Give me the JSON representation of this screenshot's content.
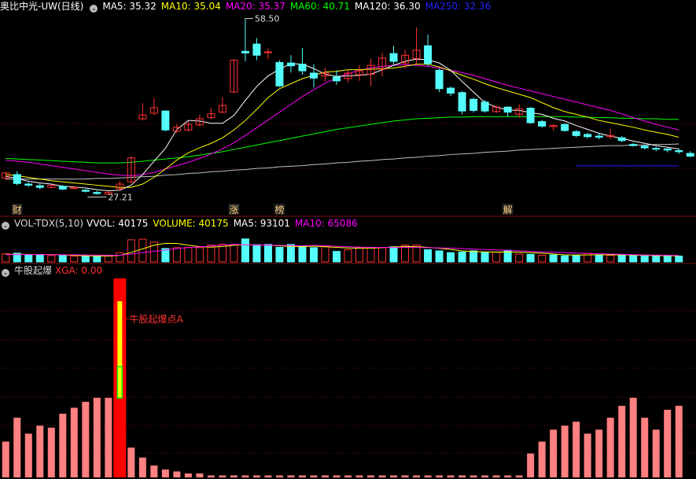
{
  "colors": {
    "up": "#ff3232",
    "down": "#54fcfc",
    "ma5": "#ffffff",
    "ma10": "#ffff00",
    "ma20": "#ff00ff",
    "ma60": "#00ff00",
    "ma120": "#c0c0c0",
    "ma250": "#2222ff",
    "grid": "#7a1010",
    "bg": "#000000"
  },
  "price_panel": {
    "stock_name": "奥比中光-UW(日线)",
    "indicators": [
      {
        "label": "MA5: 35.32",
        "color": "#ffffff"
      },
      {
        "label": "MA10: 35.04",
        "color": "#ffff00"
      },
      {
        "label": "MA20: 35.37",
        "color": "#ff00ff"
      },
      {
        "label": "MA60: 40.71",
        "color": "#00ff00"
      },
      {
        "label": "MA120: 36.30",
        "color": "#ffffff"
      },
      {
        "label": "MA250: 32.36",
        "color": "#2222ff"
      }
    ],
    "high_label": "58.50",
    "low_label": "27.21",
    "markers": [
      {
        "text": "财",
        "bar": 1
      },
      {
        "text": "涨",
        "bar": 20
      },
      {
        "text": "榜",
        "bar": 24
      },
      {
        "text": "解",
        "bar": 44
      }
    ]
  },
  "volume_panel": {
    "title": "VOL-TDX(5,10)",
    "values": [
      {
        "label": "VVOL: 40175",
        "color": "#ffffff"
      },
      {
        "label": "VOLUME: 40175",
        "color": "#ffff00"
      },
      {
        "label": "MA5: 93101",
        "color": "#ffffff"
      },
      {
        "label": "MA10: 65086",
        "color": "#ff00ff"
      }
    ]
  },
  "signal_panel": {
    "title": "牛股起爆",
    "value_label": "XGA: 0.00",
    "annotation": "牛股起爆点A"
  },
  "chart_data": {
    "type": "candlestick",
    "ylim": [
      26,
      59
    ],
    "candles": [
      {
        "o": 30.2,
        "c": 31.1,
        "h": 31.3,
        "l": 29.8
      },
      {
        "o": 30.8,
        "c": 29.2,
        "h": 31.4,
        "l": 28.9
      },
      {
        "o": 29.1,
        "c": 28.9,
        "h": 29.4,
        "l": 28.6
      },
      {
        "o": 28.8,
        "c": 28.5,
        "h": 29.2,
        "l": 28.2
      },
      {
        "o": 28.5,
        "c": 28.9,
        "h": 29.0,
        "l": 28.3
      },
      {
        "o": 28.7,
        "c": 28.2,
        "h": 28.9,
        "l": 28.0
      },
      {
        "o": 28.3,
        "c": 28.5,
        "h": 28.7,
        "l": 28.1
      },
      {
        "o": 28.0,
        "c": 27.8,
        "h": 28.2,
        "l": 27.6
      },
      {
        "o": 27.6,
        "c": 27.4,
        "h": 27.9,
        "l": 27.2
      },
      {
        "o": 27.3,
        "c": 27.6,
        "h": 27.8,
        "l": 27.21
      },
      {
        "o": 28.3,
        "c": 29.1,
        "h": 29.6,
        "l": 28.0
      },
      {
        "o": 29.5,
        "c": 33.8,
        "h": 34.0,
        "l": 29.3
      },
      {
        "o": 40.8,
        "c": 41.5,
        "h": 43.6,
        "l": 40.5
      },
      {
        "o": 41.8,
        "c": 42.8,
        "h": 44.5,
        "l": 41.5
      },
      {
        "o": 42.2,
        "c": 38.8,
        "h": 42.3,
        "l": 38.6
      },
      {
        "o": 38.6,
        "c": 39.3,
        "h": 39.8,
        "l": 38.2
      },
      {
        "o": 38.8,
        "c": 39.8,
        "h": 40.3,
        "l": 38.5
      },
      {
        "o": 39.7,
        "c": 40.8,
        "h": 41.5,
        "l": 39.5
      },
      {
        "o": 41.0,
        "c": 41.7,
        "h": 42.8,
        "l": 40.8
      },
      {
        "o": 42.0,
        "c": 43.2,
        "h": 44.7,
        "l": 41.8
      },
      {
        "o": 45.6,
        "c": 51.3,
        "h": 51.5,
        "l": 45.4
      },
      {
        "o": 52.9,
        "c": 52.6,
        "h": 58.5,
        "l": 51.1
      },
      {
        "o": 54.2,
        "c": 52.2,
        "h": 55.3,
        "l": 51.3
      },
      {
        "o": 52.8,
        "c": 52.8,
        "h": 53.4,
        "l": 51.5
      },
      {
        "o": 50.9,
        "c": 46.7,
        "h": 51.3,
        "l": 46.5
      },
      {
        "o": 50.8,
        "c": 50.3,
        "h": 52.2,
        "l": 49.1
      },
      {
        "o": 50.6,
        "c": 49.4,
        "h": 53.5,
        "l": 48.7
      },
      {
        "o": 49.0,
        "c": 48.1,
        "h": 50.6,
        "l": 46.4
      },
      {
        "o": 48.5,
        "c": 49.0,
        "h": 50.0,
        "l": 47.4
      },
      {
        "o": 48.3,
        "c": 47.6,
        "h": 49.5,
        "l": 46.9
      },
      {
        "o": 48.0,
        "c": 49.0,
        "h": 49.6,
        "l": 47.3
      },
      {
        "o": 48.7,
        "c": 49.4,
        "h": 50.4,
        "l": 47.6
      },
      {
        "o": 48.8,
        "c": 50.4,
        "h": 51.6,
        "l": 46.7
      },
      {
        "o": 49.7,
        "c": 51.7,
        "h": 52.6,
        "l": 48.4
      },
      {
        "o": 52.5,
        "c": 51.1,
        "h": 53.9,
        "l": 50.4
      },
      {
        "o": 50.8,
        "c": 52.2,
        "h": 53.2,
        "l": 49.8
      },
      {
        "o": 51.6,
        "c": 53.1,
        "h": 57.2,
        "l": 50.7
      },
      {
        "o": 53.9,
        "c": 50.7,
        "h": 55.9,
        "l": 50.2
      },
      {
        "o": 49.5,
        "c": 46.2,
        "h": 49.8,
        "l": 45.6
      },
      {
        "o": 46.3,
        "c": 45.4,
        "h": 46.6,
        "l": 44.9
      },
      {
        "o": 45.5,
        "c": 42.2,
        "h": 45.8,
        "l": 41.6
      },
      {
        "o": 44.3,
        "c": 42.3,
        "h": 44.6,
        "l": 41.9
      },
      {
        "o": 43.8,
        "c": 42.2,
        "h": 44.2,
        "l": 41.9
      },
      {
        "o": 42.1,
        "c": 42.9,
        "h": 43.2,
        "l": 41.8
      },
      {
        "o": 42.9,
        "c": 42.0,
        "h": 43.0,
        "l": 41.2
      },
      {
        "o": 41.6,
        "c": 42.6,
        "h": 43.4,
        "l": 41.0
      },
      {
        "o": 42.7,
        "c": 40.1,
        "h": 42.9,
        "l": 39.9
      },
      {
        "o": 40.3,
        "c": 39.5,
        "h": 40.6,
        "l": 39.2
      },
      {
        "o": 39.4,
        "c": 39.6,
        "h": 39.9,
        "l": 38.7
      },
      {
        "o": 39.8,
        "c": 38.7,
        "h": 40.0,
        "l": 38.5
      },
      {
        "o": 38.5,
        "c": 37.8,
        "h": 38.8,
        "l": 37.5
      },
      {
        "o": 38.0,
        "c": 37.6,
        "h": 38.3,
        "l": 37.3
      },
      {
        "o": 37.7,
        "c": 37.5,
        "h": 38.2,
        "l": 37.1
      },
      {
        "o": 37.6,
        "c": 37.8,
        "h": 39.0,
        "l": 37.2
      },
      {
        "o": 37.4,
        "c": 36.9,
        "h": 37.7,
        "l": 36.6
      },
      {
        "o": 36.2,
        "c": 36.0,
        "h": 36.5,
        "l": 35.8
      },
      {
        "o": 35.9,
        "c": 35.6,
        "h": 36.2,
        "l": 35.3
      },
      {
        "o": 35.5,
        "c": 35.4,
        "h": 35.8,
        "l": 35.0
      },
      {
        "o": 35.4,
        "c": 35.2,
        "h": 35.6,
        "l": 34.8
      },
      {
        "o": 35.1,
        "c": 34.9,
        "h": 35.5,
        "l": 34.5
      },
      {
        "o": 34.6,
        "c": 34.1,
        "h": 35.0,
        "l": 33.9
      }
    ],
    "ma5": [
      30.5,
      30.1,
      29.6,
      29.3,
      29.1,
      28.7,
      28.6,
      28.4,
      28.1,
      27.9,
      28.0,
      28.9,
      30.8,
      33.2,
      35.5,
      38.9,
      40.5,
      40.4,
      40.0,
      40.0,
      41.4,
      44.1,
      46.6,
      48.5,
      49.7,
      50.7,
      50.6,
      49.8,
      48.8,
      48.4,
      48.5,
      48.6,
      48.8,
      49.6,
      50.4,
      51.1,
      51.5,
      51.4,
      50.8,
      49.5,
      47.5,
      45.6,
      43.7,
      42.9,
      42.4,
      42.3,
      41.9,
      41.6,
      40.9,
      40.4,
      39.6,
      38.9,
      38.2,
      37.7,
      37.3,
      36.8,
      36.4,
      36.0,
      35.7,
      35.4
    ],
    "ma10": [
      30.8,
      30.6,
      30.3,
      30.0,
      29.7,
      29.5,
      29.3,
      29.1,
      28.9,
      28.7,
      28.5,
      28.5,
      29.1,
      30.3,
      31.8,
      33.4,
      34.7,
      35.6,
      36.4,
      37.4,
      38.8,
      40.5,
      42.5,
      44.6,
      46.2,
      47.1,
      48.0,
      48.6,
      49.2,
      49.3,
      49.6,
      49.6,
      49.7,
      49.8,
      49.9,
      50.2,
      50.6,
      50.6,
      50.1,
      49.4,
      48.6,
      47.9,
      47.1,
      46.4,
      45.8,
      45.2,
      44.6,
      43.7,
      42.8,
      42.1,
      41.6,
      41.1,
      40.5,
      40.1,
      39.7,
      39.3,
      38.8,
      38.4,
      38.0,
      37.5
    ],
    "ma20": [
      33.4,
      33.2,
      33.0,
      32.7,
      32.4,
      32.1,
      31.8,
      31.5,
      31.2,
      30.9,
      30.7,
      30.6,
      30.8,
      31.2,
      31.8,
      32.4,
      33.0,
      33.7,
      34.5,
      35.4,
      36.5,
      37.8,
      39.2,
      40.6,
      42.0,
      43.4,
      44.8,
      46.0,
      47.2,
      48.1,
      48.9,
      49.5,
      49.9,
      50.2,
      50.4,
      50.5,
      50.4,
      50.2,
      49.9,
      49.5,
      49.1,
      48.6,
      48.0,
      47.4,
      46.8,
      46.3,
      45.8,
      45.3,
      44.8,
      44.3,
      43.8,
      43.3,
      42.8,
      42.3,
      41.7,
      41.0,
      40.4,
      39.8,
      39.3,
      38.8
    ],
    "ma60": [
      33.7,
      33.6,
      33.5,
      33.4,
      33.3,
      33.2,
      33.1,
      33.0,
      32.9,
      32.9,
      32.9,
      33.0,
      33.2,
      33.4,
      33.6,
      33.8,
      34.0,
      34.3,
      34.6,
      34.9,
      35.3,
      35.7,
      36.1,
      36.5,
      36.9,
      37.3,
      37.7,
      38.1,
      38.5,
      38.9,
      39.2,
      39.5,
      39.8,
      40.1,
      40.4,
      40.6,
      40.8,
      40.9,
      41.0,
      41.1,
      41.1,
      41.2,
      41.2,
      41.2,
      41.2,
      41.2,
      41.2,
      41.2,
      41.2,
      41.2,
      41.1,
      41.1,
      41.0,
      41.0,
      40.9,
      40.9,
      40.8,
      40.8,
      40.7,
      40.7
    ],
    "ma120": [
      30.0,
      30.0,
      30.0,
      30.0,
      30.0,
      30.0,
      30.0,
      30.0,
      30.1,
      30.1,
      30.2,
      30.3,
      30.4,
      30.5,
      30.7,
      30.8,
      31.0,
      31.1,
      31.3,
      31.4,
      31.6,
      31.7,
      31.9,
      32.0,
      32.2,
      32.3,
      32.4,
      32.6,
      32.7,
      32.9,
      33.0,
      33.2,
      33.3,
      33.5,
      33.6,
      33.8,
      33.9,
      34.1,
      34.2,
      34.4,
      34.5,
      34.6,
      34.8,
      34.9,
      35.0,
      35.2,
      35.3,
      35.4,
      35.5,
      35.6,
      35.7,
      35.8,
      35.9,
      36.0,
      36.0,
      36.1,
      36.1,
      36.2,
      36.2,
      36.3
    ],
    "ma250": [
      null,
      null,
      null,
      null,
      null,
      null,
      null,
      null,
      null,
      null,
      null,
      null,
      null,
      null,
      null,
      null,
      null,
      null,
      null,
      null,
      null,
      null,
      null,
      null,
      null,
      null,
      null,
      null,
      null,
      null,
      null,
      null,
      null,
      null,
      null,
      null,
      null,
      null,
      null,
      null,
      null,
      null,
      null,
      null,
      null,
      null,
      null,
      null,
      null,
      null,
      32.36,
      32.36,
      32.36,
      32.36,
      32.36,
      32.36,
      32.36,
      32.36,
      32.36,
      32.36
    ],
    "volume": {
      "ylim": [
        0,
        500000
      ],
      "bars": [
        140000,
        150000,
        120000,
        115000,
        110000,
        112000,
        100000,
        98000,
        95000,
        100000,
        160000,
        380000,
        390000,
        340000,
        230000,
        245000,
        250000,
        245000,
        290000,
        300000,
        300000,
        395000,
        295000,
        300000,
        250000,
        300000,
        275000,
        245000,
        265000,
        180000,
        210000,
        250000,
        250000,
        250000,
        260000,
        290000,
        290000,
        210000,
        190000,
        160000,
        170000,
        190000,
        170000,
        165000,
        200000,
        135000,
        130000,
        115000,
        120000,
        105000,
        110000,
        150000,
        115000,
        115000,
        120000,
        110000,
        100000,
        105000,
        110000,
        100000
      ],
      "up": [
        true,
        false,
        false,
        false,
        true,
        false,
        true,
        false,
        false,
        true,
        true,
        true,
        true,
        true,
        false,
        true,
        true,
        true,
        true,
        true,
        true,
        false,
        false,
        false,
        false,
        false,
        false,
        false,
        true,
        false,
        true,
        true,
        true,
        true,
        false,
        true,
        true,
        false,
        false,
        false,
        false,
        false,
        false,
        true,
        false,
        true,
        false,
        true,
        false,
        false,
        false,
        true,
        false,
        true,
        false,
        false,
        false,
        false,
        false,
        false
      ],
      "ma5": [
        130000,
        132000,
        130000,
        128000,
        127000,
        121000,
        112000,
        107000,
        103000,
        101000,
        113000,
        163000,
        225000,
        287000,
        320000,
        317000,
        287000,
        262000,
        253000,
        266000,
        285000,
        298000,
        290000,
        290000,
        275000,
        268000,
        261000,
        270000,
        260000,
        250000,
        240000,
        235000,
        236000,
        245000,
        255000,
        265000,
        262000,
        250000,
        235000,
        215000,
        190000,
        178000,
        173000,
        169000,
        170000,
        165000,
        158000,
        150000,
        135000,
        122000,
        118000,
        120000,
        123000,
        121000,
        123000,
        118000,
        114000,
        110000,
        108000,
        105000
      ],
      "ma10": [
        125000,
        126000,
        126000,
        126000,
        125000,
        124000,
        122000,
        120000,
        117000,
        114000,
        117000,
        135000,
        160000,
        180000,
        205000,
        230000,
        245000,
        258000,
        270000,
        290000,
        300000,
        296000,
        288000,
        290000,
        283000,
        282000,
        279000,
        283000,
        278000,
        268000,
        260000,
        254000,
        250000,
        248000,
        247000,
        250000,
        249000,
        245000,
        240000,
        238000,
        228000,
        220000,
        212000,
        205000,
        200000,
        190000,
        180000,
        172000,
        165000,
        160000,
        150000,
        145000,
        140000,
        135000,
        130000,
        125000,
        120000,
        118000,
        115000,
        112000
      ]
    },
    "signal": {
      "ylim": [
        0,
        100
      ],
      "bars": [
        18,
        30,
        22,
        26,
        25,
        32,
        35,
        38,
        40,
        40,
        100,
        15,
        10,
        6,
        4,
        3,
        2,
        2,
        1,
        1,
        1,
        1,
        1,
        1,
        1,
        1,
        1,
        1,
        1,
        1,
        1,
        1,
        1,
        1,
        1,
        1,
        1,
        1,
        1,
        1,
        1,
        1,
        1,
        1,
        1,
        1,
        12,
        18,
        24,
        26,
        28,
        22,
        24,
        30,
        36,
        40,
        30,
        24,
        34,
        36
      ],
      "burst_index": 10
    }
  }
}
